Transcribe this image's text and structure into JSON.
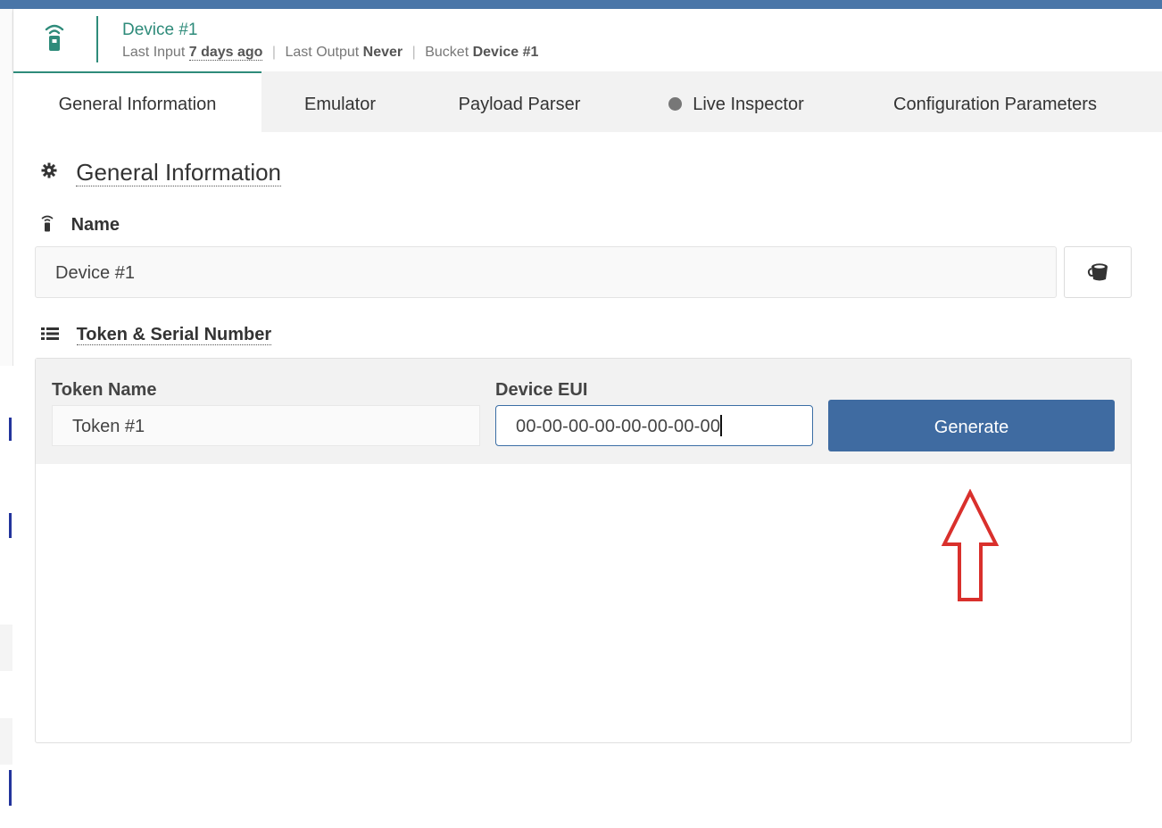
{
  "header": {
    "title": "Device #1",
    "last_input_label": "Last Input",
    "last_input_value": "7 days ago",
    "last_output_label": "Last Output",
    "last_output_value": "Never",
    "bucket_label": "Bucket",
    "bucket_value": "Device #1",
    "separator": "|"
  },
  "tabs": [
    {
      "label": "General Information",
      "active": true
    },
    {
      "label": "Emulator",
      "active": false
    },
    {
      "label": "Payload Parser",
      "active": false
    },
    {
      "label": "Live Inspector",
      "active": false,
      "status_dot": true
    },
    {
      "label": "Configuration Parameters",
      "active": false
    }
  ],
  "main": {
    "section_title": "General Information",
    "name_label": "Name",
    "name_value": "Device #1",
    "token_section_title": "Token & Serial Number",
    "token_name_label": "Token Name",
    "token_name_value": "Token #1",
    "device_eui_label": "Device EUI",
    "device_eui_value": "00-00-00-00-00-00-00-00",
    "generate_label": "Generate"
  },
  "colors": {
    "accent": "#2e8b7a",
    "primary_button": "#3f6ba1",
    "topbar": "#4a76a8",
    "annotation_arrow": "#d9302c"
  },
  "icons": {
    "device": "remote-device-icon",
    "section": "gear-icon",
    "list": "list-icon",
    "bucket": "bucket-icon",
    "annotation": "arrow-up-outline-icon"
  }
}
